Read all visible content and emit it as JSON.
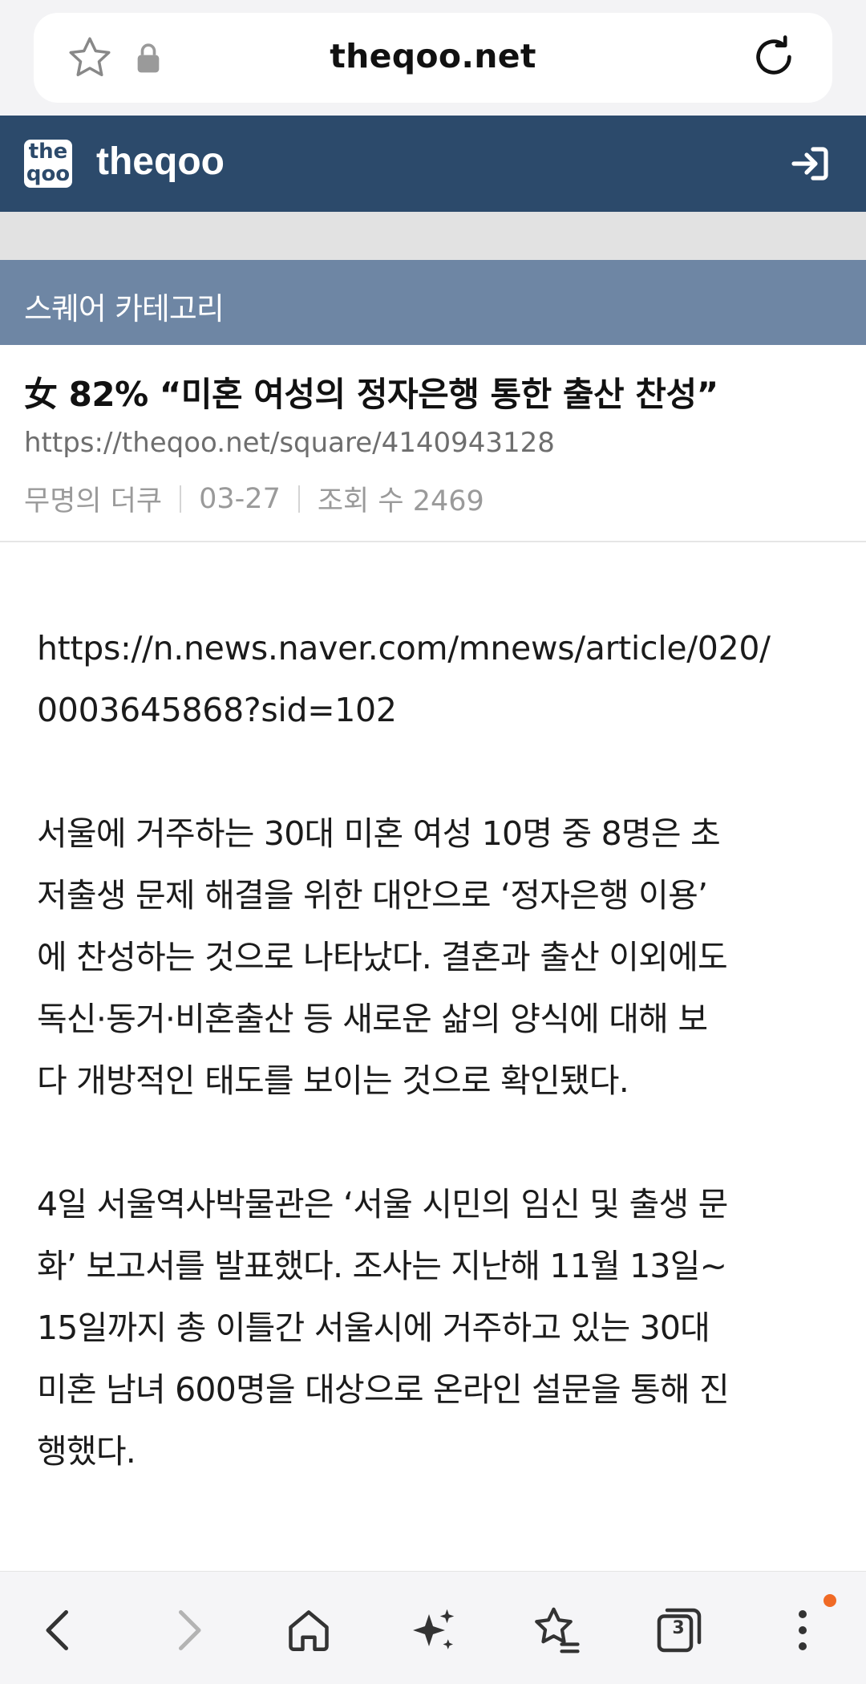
{
  "browser": {
    "domain": "theqoo.net"
  },
  "site": {
    "name": "theqoo",
    "logo_line1": "the",
    "logo_line2": "qoo"
  },
  "category": {
    "label": "스퀘어 카테고리"
  },
  "post": {
    "title": "女 82% “미혼 여성의 정자은행 통한 출산 찬성”",
    "url": "https://theqoo.net/square/4140943128",
    "author": "무명의 더쿠",
    "date": "03-27",
    "views": "조회 수 2469"
  },
  "article": {
    "link_line1": "https://n.news.naver.com/mnews/article/020/",
    "link_line2": "0003645868?sid=102",
    "para1": [
      "서울에 거주하는 30대 미혼 여성 10명 중 8명은 초",
      "저출생 문제 해결을 위한 대안으로 ‘정자은행 이용’",
      "에 찬성하는 것으로 나타났다. 결혼과 출산 이외에도",
      "독신·동거·비혼출산 등 새로운 삶의 양식에 대해 보",
      "다 개방적인 태도를 보이는 것으로 확인됐다."
    ],
    "para2": [
      "4일 서울역사박물관은 ‘서울 시민의 임신 및 출생 문",
      "화’ 보고서를 발표했다. 조사는 지난해 11월 13일~",
      "15일까지 총 이틀간 서울시에 거주하고 있는 30대",
      "미혼 남녀 600명을 대상으로 온라인 설문을 통해 진",
      "행했다."
    ]
  },
  "bottom_nav": {
    "tab_count": "3",
    "icons": [
      "back-icon",
      "forward-icon",
      "home-icon",
      "ai-sparkle-icon",
      "bookmarks-icon",
      "tabs-icon",
      "more-icon"
    ]
  },
  "colors": {
    "header_bg": "#2c4a6b",
    "category_bg": "#6e86a4",
    "notify_dot": "#f06a25"
  }
}
